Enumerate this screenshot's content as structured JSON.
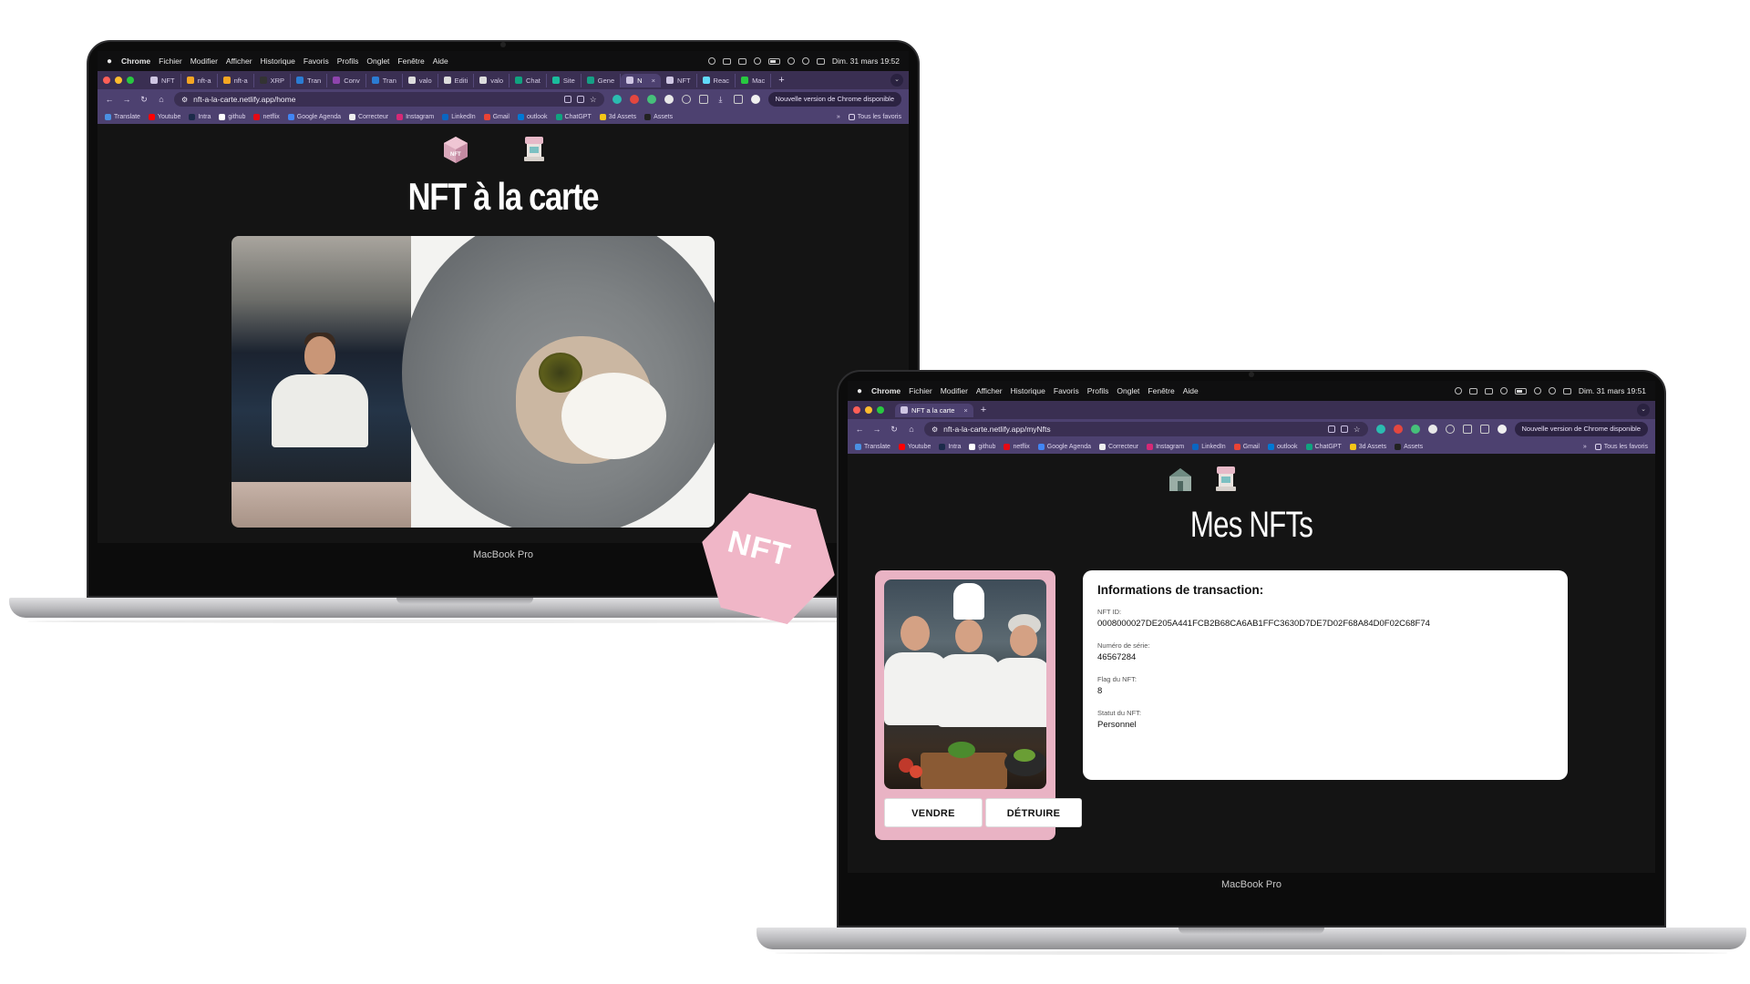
{
  "laptops": {
    "model_label": "MacBook Pro"
  },
  "menubar": {
    "app": "Chrome",
    "items": [
      "Fichier",
      "Modifier",
      "Afficher",
      "Historique",
      "Favoris",
      "Profils",
      "Onglet",
      "Fenêtre",
      "Aide"
    ],
    "clock_left": "Dim. 31 mars  19:52",
    "clock_right": "Dim. 31 mars  19:51"
  },
  "left_browser": {
    "tabs": [
      "NFT",
      "nft-a",
      "nft-a",
      "XRP",
      "Tran",
      "Conv",
      "Tran",
      "valo",
      "Editi",
      "valo",
      "Chat",
      "Site",
      "Gene",
      "N",
      "NFT",
      "Reac",
      "Mac"
    ],
    "active_tab_index": 13,
    "url": "nft-a-la-carte.netlify.app/home",
    "update_pill": "Nouvelle version de Chrome disponible"
  },
  "right_browser": {
    "active_tab": "NFT a la carte",
    "url": "nft-a-la-carte.netlify.app/myNfts",
    "update_pill": "Nouvelle version de Chrome disponible"
  },
  "bookmarks": [
    {
      "label": "Translate",
      "color": "#4a90e2"
    },
    {
      "label": "Youtube",
      "color": "#ff0000"
    },
    {
      "label": "Intra",
      "color": "#1c2b4a"
    },
    {
      "label": "github",
      "color": "#ffffff"
    },
    {
      "label": "netflix",
      "color": "#e50914"
    },
    {
      "label": "Google Agenda",
      "color": "#4285f4"
    },
    {
      "label": "Correcteur",
      "color": "#eeeeee"
    },
    {
      "label": "Instagram",
      "color": "#d62976"
    },
    {
      "label": "LinkedIn",
      "color": "#0a66c2"
    },
    {
      "label": "Gmail",
      "color": "#ea4335"
    },
    {
      "label": "outlook",
      "color": "#0078d4"
    },
    {
      "label": "ChatGPT",
      "color": "#10a37f"
    },
    {
      "label": "3d Assets",
      "color": "#f5c518"
    },
    {
      "label": "Assets",
      "color": "#222222"
    }
  ],
  "bookmarks_overflow": "»",
  "bookmarks_all": "Tous les favoris",
  "home_page": {
    "title": "NFT à la carte",
    "badge_text": "NFT"
  },
  "mynfts_page": {
    "title": "Mes NFTs",
    "sell_button": "VENDRE",
    "destroy_button": "DÉTRUIRE",
    "info": {
      "heading": "Informations de transaction:",
      "fields": [
        {
          "label": "NFT ID:",
          "value": "0008000027DE205A441FCB2B68CA6AB1FFC3630D7DE7D02F68A84D0F02C68F74"
        },
        {
          "label": "Numéro de série:",
          "value": "46567284"
        },
        {
          "label": "Flag du NFT:",
          "value": "8"
        },
        {
          "label": "Statut du NFT:",
          "value": "Personnel"
        }
      ]
    }
  },
  "colors": {
    "page_bg": "#141414",
    "chrome_frame": "#4d4170",
    "tab_strip": "#3a2f52",
    "accent_pink": "#e9b3c4"
  }
}
